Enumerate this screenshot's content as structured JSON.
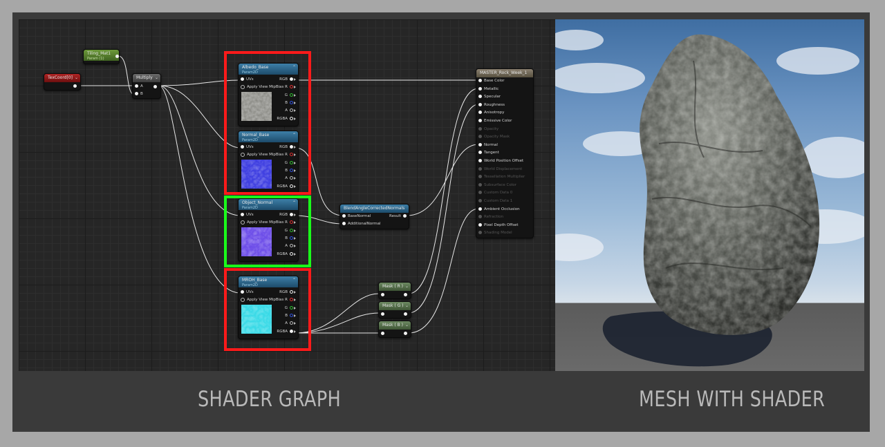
{
  "captions": {
    "left": "SHADER GRAPH",
    "right": "MESH WITH SHADER"
  },
  "highlight_colors": {
    "red": "#ff1a1a",
    "green": "#1aff1a"
  },
  "nodes": {
    "tiling": {
      "title": "Tiling_Mat1",
      "subtitle": "Param (1)"
    },
    "texcoord": {
      "title": "TexCoord[0]"
    },
    "multiply": {
      "title": "Multiply",
      "pin_a": "A",
      "pin_b": "B"
    },
    "albedo": {
      "title": "Albedo_Base",
      "subtitle": "Param2D"
    },
    "normal": {
      "title": "Normal_Base",
      "subtitle": "Param2D"
    },
    "object_normal": {
      "title": "Object_Normal",
      "subtitle": "Param2D"
    },
    "mroh": {
      "title": "MROH_Base",
      "subtitle": "Param2D"
    },
    "texture_pins": {
      "uvs": "UVs",
      "mip": "Apply View MipBias",
      "rgb": "RGB",
      "r": "R",
      "g": "G",
      "b": "B",
      "a": "A",
      "rgba": "RGBA"
    },
    "blend": {
      "title": "BlendAngleCorrectedNormals",
      "in1": "BaseNormal",
      "in2": "AdditionalNormal",
      "out": "Result"
    },
    "masks": [
      {
        "title": "Mask ( R )"
      },
      {
        "title": "Mask ( G )"
      },
      {
        "title": "Mask ( B )"
      }
    ],
    "master": {
      "title": "MASTER_Rock_Week_1",
      "inputs": [
        {
          "label": "Base Color",
          "active": true
        },
        {
          "label": "Metallic",
          "active": true
        },
        {
          "label": "Specular",
          "active": true
        },
        {
          "label": "Roughness",
          "active": true
        },
        {
          "label": "Anisotropy",
          "active": true
        },
        {
          "label": "Emissive Color",
          "active": true
        },
        {
          "label": "Opacity",
          "active": false
        },
        {
          "label": "Opacity Mask",
          "active": false
        },
        {
          "label": "Normal",
          "active": true
        },
        {
          "label": "Tangent",
          "active": true
        },
        {
          "label": "World Position Offset",
          "active": true
        },
        {
          "label": "World Displacement",
          "active": false
        },
        {
          "label": "Tessellation Multiplier",
          "active": false
        },
        {
          "label": "Subsurface Color",
          "active": false
        },
        {
          "label": "Custom Data 0",
          "active": false
        },
        {
          "label": "Custom Data 1",
          "active": false
        },
        {
          "label": "Ambient Occlusion",
          "active": true
        },
        {
          "label": "Refraction",
          "active": false
        },
        {
          "label": "Pixel Depth Offset",
          "active": true
        },
        {
          "label": "Shading Model",
          "active": false
        }
      ]
    }
  }
}
